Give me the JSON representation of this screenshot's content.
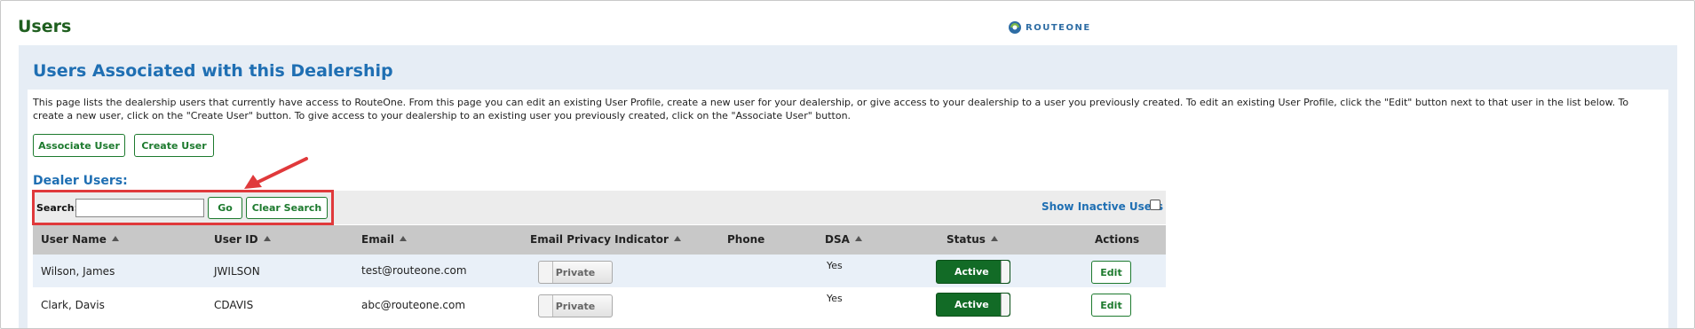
{
  "page": {
    "title": "Users"
  },
  "logo": {
    "text": "ROUTEONE"
  },
  "section": {
    "title": "Users Associated with this Dealership",
    "description": "This page lists the dealership users that currently have access to RouteOne. From this page you can edit an existing User Profile, create a new user for your dealership, or give access to your dealership to a user you previously created. To edit an existing User Profile, click the \"Edit\" button next to that user in the list below. To create a new user, click on the \"Create User\" button. To give access to your dealership to an existing user you previously created, click on the \"Associate User\" button."
  },
  "actions": {
    "associate_label": "Associate User",
    "create_label": "Create User"
  },
  "dealer_users": {
    "heading": "Dealer Users:"
  },
  "search": {
    "label": "Search:",
    "value": "",
    "placeholder": "",
    "go_label": "Go",
    "clear_label": "Clear Search",
    "show_inactive_label": "Show Inactive Users",
    "show_inactive_checked": false
  },
  "table": {
    "headers": [
      "User Name",
      "User ID",
      "Email",
      "Email Privacy Indicator",
      "Phone",
      "DSA",
      "Status",
      "Actions"
    ],
    "rows": [
      {
        "user_name": "Wilson, James",
        "user_id": "JWILSON",
        "email": "test@routeone.com",
        "privacy": "Private",
        "phone": "",
        "dsa": "Yes",
        "status": "Active",
        "action": "Edit"
      },
      {
        "user_name": "Clark, Davis",
        "user_id": "CDAVIS",
        "email": "abc@routeone.com",
        "privacy": "Private",
        "phone": "",
        "dsa": "Yes",
        "status": "Active",
        "action": "Edit"
      }
    ]
  },
  "colors": {
    "brand_green": "#1f5f1f",
    "accent_blue": "#1f6fb3",
    "active_green": "#126b26",
    "highlight_red": "#e0393b"
  },
  "icons": {
    "logo": "routeone-logo-icon",
    "sort": "sort-ascending-icon",
    "annotation": "red-arrow-icon"
  }
}
